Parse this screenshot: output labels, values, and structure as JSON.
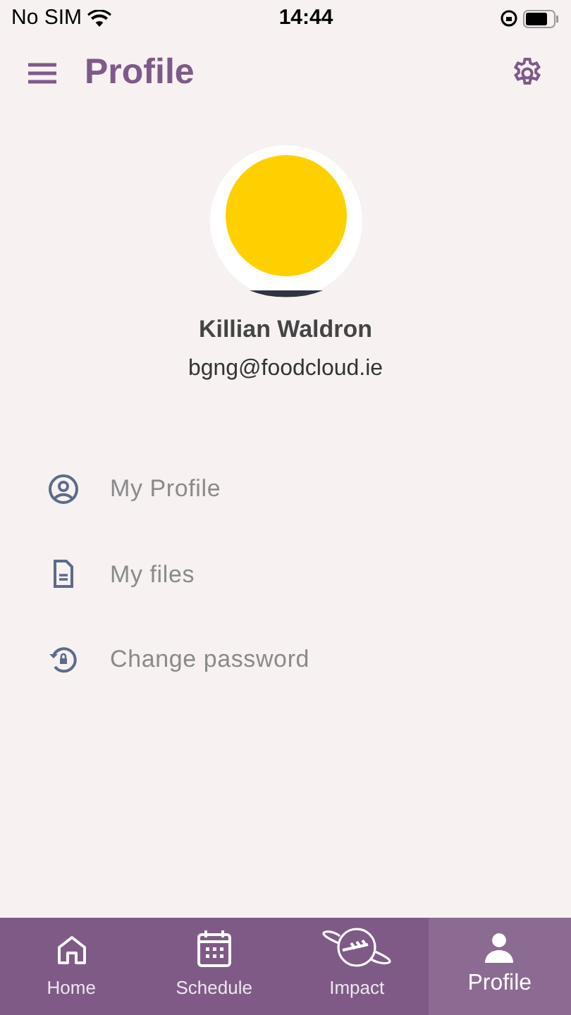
{
  "status_bar": {
    "carrier": "No SIM",
    "time": "14:44"
  },
  "header": {
    "title": "Profile"
  },
  "profile": {
    "name": "Killian Waldron",
    "email": "bgng@foodcloud.ie"
  },
  "menu": [
    {
      "kind": "profile",
      "label": "My Profile"
    },
    {
      "kind": "files",
      "label": "My files"
    },
    {
      "kind": "password",
      "label": "Change password"
    }
  ],
  "tabs": [
    {
      "kind": "home",
      "label": "Home",
      "selected": false
    },
    {
      "kind": "schedule",
      "label": "Schedule",
      "selected": false
    },
    {
      "kind": "impact",
      "label": "Impact",
      "selected": false
    },
    {
      "kind": "profile",
      "label": "Profile",
      "selected": true
    }
  ]
}
